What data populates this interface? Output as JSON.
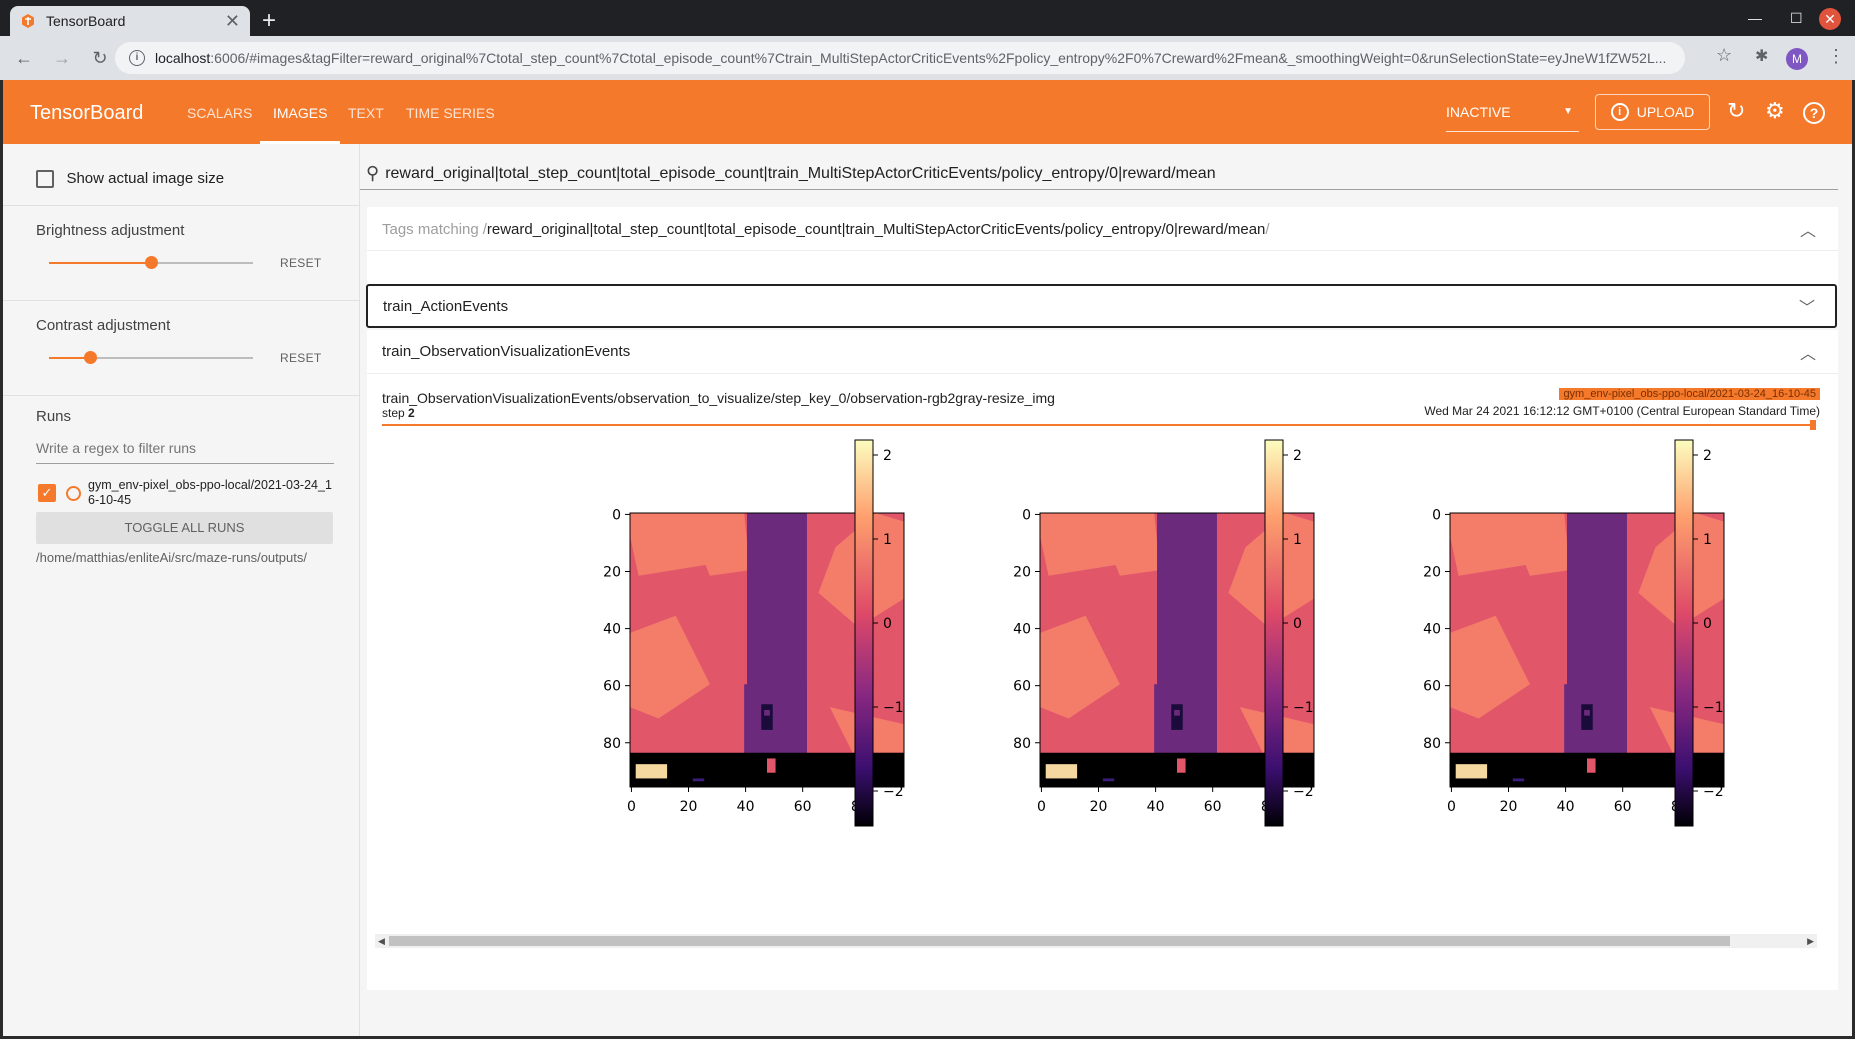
{
  "browser": {
    "tab_title": "TensorBoard",
    "url_host": "localhost",
    "url_rest": ":6006/#images&tagFilter=reward_original%7Ctotal_step_count%7Ctotal_episode_count%7Ctrain_MultiStepActorCriticEvents%2Fpolicy_entropy%2F0%7Creward%2Fmean&_smoothingWeight=0&runSelectionState=eyJneW1fZW52L...",
    "profile_initial": "M"
  },
  "header": {
    "brand": "TensorBoard",
    "tabs": [
      "SCALARS",
      "IMAGES",
      "TEXT",
      "TIME SERIES"
    ],
    "active_tab": "IMAGES",
    "status_select": "INACTIVE",
    "upload_label": "UPLOAD"
  },
  "sidebar": {
    "show_actual_size_label": "Show actual image size",
    "brightness_label": "Brightness adjustment",
    "brightness_value": 0.5,
    "contrast_label": "Contrast adjustment",
    "contrast_value": 0.2,
    "reset_label": "RESET",
    "runs_title": "Runs",
    "runs_filter_placeholder": "Write a regex to filter runs",
    "run_name": "gym_env-pixel_obs-ppo-local/2021-03-24_16-10-45",
    "toggle_all_label": "TOGGLE ALL RUNS",
    "logdir": "/home/matthias/enliteAi/src/maze-runs/outputs/"
  },
  "main": {
    "search_value": "reward_original|total_step_count|total_episode_count|train_MultiStepActorCriticEvents/policy_entropy/0|reward/mean",
    "tags_matching_label": "Tags matching",
    "tags_matching_value": "reward_original|total_step_count|total_episode_count|train_MultiStepActorCriticEvents/policy_entropy/0|reward/mean",
    "slash_open": "/",
    "slash_close": "/",
    "group_action": "train_ActionEvents",
    "group_observation": "train_ObservationVisualizationEvents",
    "image_card": {
      "title": "train_ObservationVisualizationEvents/observation_to_visualize/step_key_0/observation-rgb2gray-resize_img",
      "step_label": "step",
      "step_value": "2",
      "run_badge": "gym_env-pixel_obs-ppo-local/2021-03-24_16-10-45",
      "timestamp": "Wed Mar 24 2021 16:12:12 GMT+0100 (Central European Standard Time)",
      "step_position": 1.0
    }
  },
  "chart_data": [
    {
      "type": "heatmap",
      "x_ticks": [
        0,
        20,
        40,
        60,
        80
      ],
      "y_ticks": [
        0,
        20,
        40,
        60,
        80
      ],
      "colorbar_ticks": [
        "2",
        "1",
        "0",
        "−1",
        "−2"
      ],
      "colormap": "magma"
    },
    {
      "type": "heatmap",
      "x_ticks": [
        0,
        20,
        40,
        60,
        80
      ],
      "y_ticks": [
        0,
        20,
        40,
        60,
        80
      ],
      "colorbar_ticks": [
        "2",
        "1",
        "0",
        "−1",
        "−2"
      ],
      "colormap": "magma"
    },
    {
      "type": "heatmap",
      "x_ticks": [
        0,
        20,
        40,
        60,
        80
      ],
      "y_ticks": [
        0,
        20,
        40,
        60,
        80
      ],
      "colorbar_ticks": [
        "2",
        "1",
        "0",
        "−1",
        "−2"
      ],
      "colormap": "magma"
    }
  ],
  "colors": {
    "accent": "#f5792a",
    "road": "#6b2a7c",
    "grass": "#e2566a",
    "block": "#f47d6a"
  }
}
